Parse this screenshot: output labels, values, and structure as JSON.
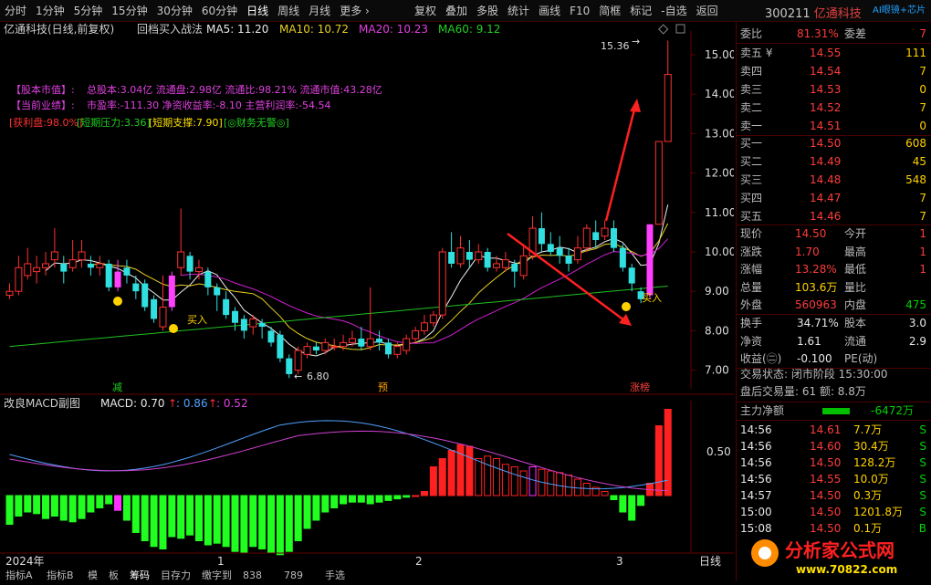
{
  "toolbar": {
    "left": [
      "分时",
      "1分钟",
      "5分钟",
      "15分钟",
      "30分钟",
      "60分钟",
      "日线",
      "周线",
      "月线",
      "更多 ›"
    ],
    "right": [
      "复权",
      "叠加",
      "多股",
      "统计",
      "画线",
      "F10",
      "简框",
      "标记",
      "-自选",
      "返回"
    ]
  },
  "stock": {
    "code": "300211",
    "name": "亿通科技",
    "ai_label": "AI眼镜+芯片"
  },
  "main_chart": {
    "header": {
      "name": "亿通科技(日线,前复权)",
      "indicator": "回档买入战法",
      "ma5": "MA5: 11.20",
      "ma10": "MA10: 10.72",
      "ma20": "MA20: 10.23",
      "ma60": "MA60: 9.12"
    },
    "info_lines": [
      {
        "label": "【股本市值】:",
        "text": "总股本:3.04亿 流通盘:2.98亿 流通比:98.21% 流通市值:43.28亿"
      },
      {
        "label": "【当前业绩】:",
        "text": "市盈率:-111.30 净资收益率:-8.10 主营利润率:-54.54"
      }
    ],
    "info_line3": {
      "a": "[获利盘:98.0%]",
      "b": "[短期压力:3.36]",
      "c": "[短期支撑:7.90]",
      "d": "[◎财务无警◎]"
    },
    "y_ticks": [
      "15.00",
      "14.00",
      "13.00",
      "12.00",
      "11.00",
      "10.00",
      "9.00",
      "8.00",
      "7.00"
    ],
    "max_label": "15.36",
    "min_label": "6.80",
    "buy_label": "买入",
    "tag_jian": "减",
    "tag_yu": "预",
    "tag_zt": "涨榜"
  },
  "macd": {
    "title": "改良MACD副图",
    "macd": "MACD: 0.70",
    "v1": ": 0.86",
    "v2": ": 0.52",
    "y_tick": "0.50"
  },
  "x_axis": {
    "labels": [
      "2024年",
      "1",
      "2",
      "3"
    ],
    "right": "日线"
  },
  "bottom_tabs": [
    "指标A",
    "指标B",
    "模",
    "板",
    "筹码",
    "目存力",
    "缴字到",
    "838",
    "789",
    "手选"
  ],
  "panel": {
    "ratio": {
      "wb_label": "委比",
      "wb": "81.31%",
      "wc_label": "委差",
      "wc": "7"
    },
    "asks": [
      {
        "l": "卖五 ¥",
        "p": "14.55",
        "v": "111"
      },
      {
        "l": "卖四",
        "p": "14.54",
        "v": "7"
      },
      {
        "l": "卖三",
        "p": "14.53",
        "v": "0"
      },
      {
        "l": "卖二",
        "p": "14.52",
        "v": "7"
      },
      {
        "l": "卖一",
        "p": "14.51",
        "v": "0"
      }
    ],
    "bids": [
      {
        "l": "买一",
        "p": "14.50",
        "v": "608"
      },
      {
        "l": "买二",
        "p": "14.49",
        "v": "45"
      },
      {
        "l": "买三",
        "p": "14.48",
        "v": "548"
      },
      {
        "l": "买四",
        "p": "14.47",
        "v": "7"
      },
      {
        "l": "买五",
        "p": "14.46",
        "v": "7"
      }
    ],
    "quote": [
      {
        "l1": "现价",
        "v1": "14.50",
        "l2": "今开",
        "v2": "1"
      },
      {
        "l1": "涨跌",
        "v1": "1.70",
        "l2": "最高",
        "v2": "1"
      },
      {
        "l1": "涨幅",
        "v1": "13.28%",
        "l2": "最低",
        "v2": "1"
      },
      {
        "l1": "总量",
        "v1": "103.6万",
        "l2": "量比",
        "v2": ""
      },
      {
        "l1": "外盘",
        "v1": "560963",
        "l2": "内盘",
        "v2": "475"
      }
    ],
    "stats": [
      {
        "l1": "换手",
        "v1": "34.71%",
        "l2": "股本",
        "v2": "3.0"
      },
      {
        "l1": "净资",
        "v1": "1.61",
        "l2": "流通",
        "v2": "2.9"
      },
      {
        "l1": "收益(㊁)",
        "v1": "-0.100",
        "l2": "PE(动)",
        "v2": ""
      }
    ],
    "status": {
      "state": "交易状态: 闭市阶段 15:30:00",
      "after": "盘后交易量: 61  额: 8.8万"
    },
    "flow": {
      "label": "主力净额",
      "value": "-6472万"
    },
    "ticks": [
      {
        "t": "14:56",
        "p": "14.61",
        "v": "7.7万",
        "d": "S"
      },
      {
        "t": "14:56",
        "p": "14.60",
        "v": "30.4万",
        "d": "S"
      },
      {
        "t": "14:56",
        "p": "14.50",
        "v": "128.2万",
        "d": "S"
      },
      {
        "t": "14:56",
        "p": "14.55",
        "v": "10.0万",
        "d": "S"
      },
      {
        "t": "14:57",
        "p": "14.50",
        "v": "0.3万",
        "d": "S"
      },
      {
        "t": "15:00",
        "p": "14.50",
        "v": "1201.8万",
        "d": "S"
      },
      {
        "t": "15:08",
        "p": "14.50",
        "v": "0.1万",
        "d": "B"
      }
    ]
  },
  "watermark": {
    "text": "分析家公式网",
    "url": "www.70822.com"
  }
}
